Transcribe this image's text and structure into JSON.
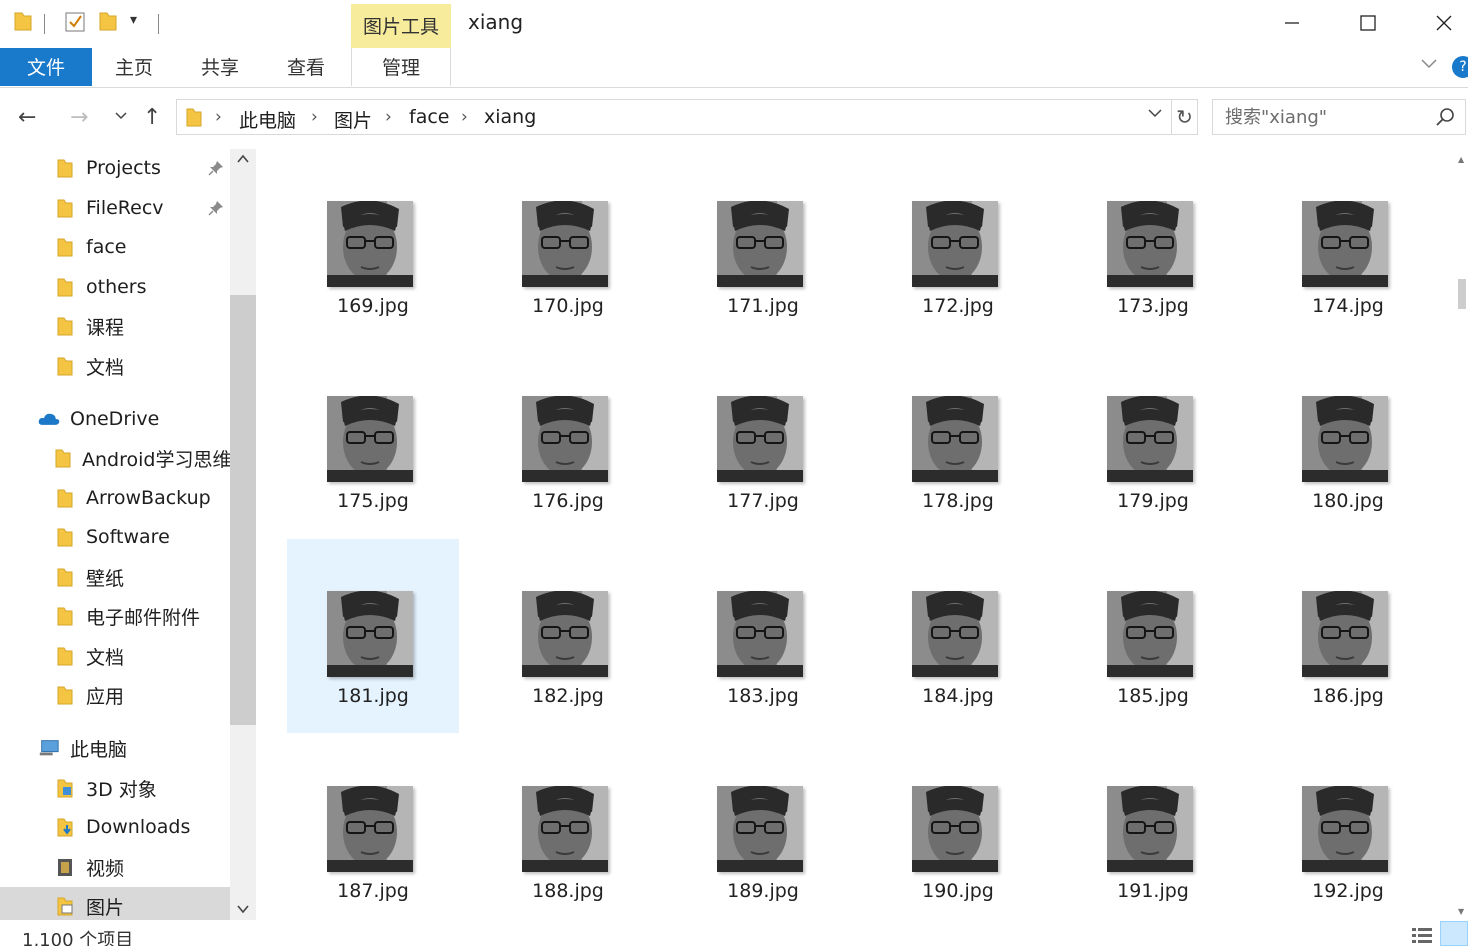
{
  "window": {
    "title": "xiang",
    "context_header": "图片工具",
    "controls": {
      "minimize": "—",
      "maximize": "☐",
      "close": "✕"
    }
  },
  "ribbon": {
    "tabs": [
      {
        "label": "文件",
        "active": true
      },
      {
        "label": "主页"
      },
      {
        "label": "共享"
      },
      {
        "label": "查看"
      },
      {
        "label": "管理"
      }
    ],
    "help": "?"
  },
  "address": {
    "breadcrumbs": [
      "此电脑",
      "图片",
      "face",
      "xiang"
    ]
  },
  "search": {
    "placeholder": "搜索\"xiang\""
  },
  "nav_pane": {
    "items": [
      {
        "label": "Projects",
        "icon": "folder-icon",
        "pinned": true
      },
      {
        "label": "FileRecv",
        "icon": "folder-icon",
        "pinned": true
      },
      {
        "label": "face",
        "icon": "folder-icon"
      },
      {
        "label": "others",
        "icon": "folder-icon"
      },
      {
        "label": "课程",
        "icon": "folder-icon"
      },
      {
        "label": "文档",
        "icon": "folder-icon"
      },
      {
        "label": "OneDrive",
        "icon": "cloud-icon"
      },
      {
        "label": "Android学习思维",
        "icon": "folder-icon"
      },
      {
        "label": "ArrowBackup",
        "icon": "folder-icon"
      },
      {
        "label": "Software",
        "icon": "folder-icon"
      },
      {
        "label": "壁纸",
        "icon": "folder-icon"
      },
      {
        "label": "电子邮件附件",
        "icon": "folder-icon"
      },
      {
        "label": "文档",
        "icon": "folder-icon"
      },
      {
        "label": "应用",
        "icon": "folder-icon"
      },
      {
        "label": "此电脑",
        "icon": "computer-icon"
      },
      {
        "label": "3D 对象",
        "icon": "3d-objects-icon"
      },
      {
        "label": "Downloads",
        "icon": "downloads-icon"
      },
      {
        "label": "视频",
        "icon": "video-icon"
      },
      {
        "label": "图片",
        "icon": "pictures-icon",
        "selected": true
      }
    ]
  },
  "files": [
    "169.jpg",
    "170.jpg",
    "171.jpg",
    "172.jpg",
    "173.jpg",
    "174.jpg",
    "175.jpg",
    "176.jpg",
    "177.jpg",
    "178.jpg",
    "179.jpg",
    "180.jpg",
    "181.jpg",
    "182.jpg",
    "183.jpg",
    "184.jpg",
    "185.jpg",
    "186.jpg",
    "187.jpg",
    "188.jpg",
    "189.jpg",
    "190.jpg",
    "191.jpg",
    "192.jpg"
  ],
  "selected_file": "181.jpg",
  "status": {
    "item_count": "1,100 个项目"
  },
  "colors": {
    "accent": "#1979ca",
    "context_tab": "#f7eb9c",
    "selection": "#e5f3ff",
    "folder": "#f4c542"
  }
}
